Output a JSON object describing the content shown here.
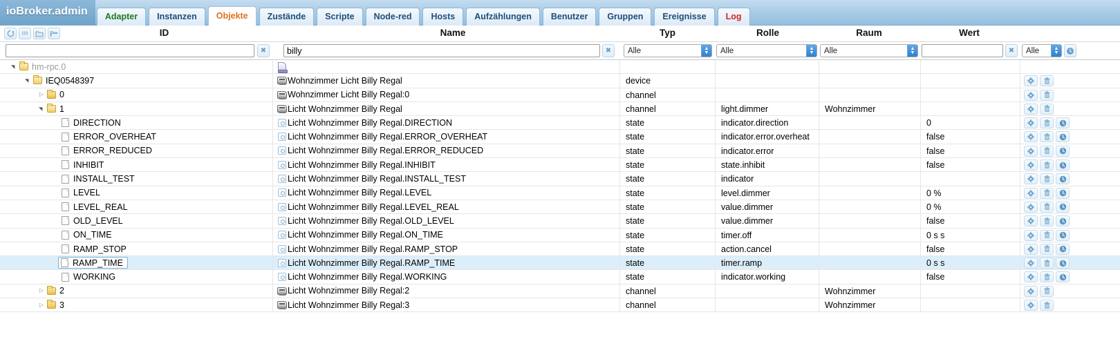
{
  "app": {
    "brand": "ioBroker.admin"
  },
  "tabs": [
    {
      "label": "Adapter",
      "style": "green",
      "active": false
    },
    {
      "label": "Instanzen",
      "style": "normal",
      "active": false
    },
    {
      "label": "Objekte",
      "style": "normal",
      "active": true
    },
    {
      "label": "Zustände",
      "style": "normal",
      "active": false
    },
    {
      "label": "Scripte",
      "style": "normal",
      "active": false
    },
    {
      "label": "Node-red",
      "style": "normal",
      "active": false
    },
    {
      "label": "Hosts",
      "style": "normal",
      "active": false
    },
    {
      "label": "Aufzählungen",
      "style": "normal",
      "active": false
    },
    {
      "label": "Benutzer",
      "style": "normal",
      "active": false
    },
    {
      "label": "Gruppen",
      "style": "normal",
      "active": false
    },
    {
      "label": "Ereignisse",
      "style": "normal",
      "active": false
    },
    {
      "label": "Log",
      "style": "red",
      "active": false
    }
  ],
  "toolbar": {
    "buttons": [
      {
        "name": "refresh-icon",
        "title": "Aktualisieren"
      },
      {
        "name": "list-icon",
        "title": "Liste"
      },
      {
        "name": "collapse-all-icon",
        "title": "Alle einklappen"
      },
      {
        "name": "expand-all-icon",
        "title": "Alle ausklappen"
      }
    ]
  },
  "columns": {
    "id": "ID",
    "name": "Name",
    "typ": "Typ",
    "rolle": "Rolle",
    "raum": "Raum",
    "wert": "Wert"
  },
  "filters": {
    "id_value": "",
    "id_placeholder": "",
    "name_value": "billy",
    "name_placeholder": "",
    "typ_value": "Alle",
    "rolle_value": "Alle",
    "raum_value": "Alle",
    "wert_value": "",
    "wert_placeholder": "",
    "quality_value": "Alle",
    "clear_label": "✖",
    "select_options": [
      "Alle"
    ]
  },
  "rows": [
    {
      "indent": 0,
      "arrow": "open",
      "icon": "folder",
      "id": "hm-rpc.0",
      "id_dim": true,
      "name": "",
      "name_icon": "adapter",
      "typ": "",
      "rolle": "",
      "raum": "",
      "wert": "",
      "actions": [],
      "selected": false
    },
    {
      "indent": 1,
      "arrow": "open",
      "icon": "folder",
      "id": "IEQ0548397",
      "id_dim": false,
      "name": "Wohnzimmer Licht Billy Regal",
      "name_icon": "device",
      "typ": "device",
      "rolle": "",
      "raum": "",
      "wert": "",
      "actions": [
        "gear",
        "trash"
      ],
      "selected": false
    },
    {
      "indent": 2,
      "arrow": "closed",
      "icon": "folder",
      "id": "0",
      "id_dim": false,
      "name": "Wohnzimmer Licht Billy Regal:0",
      "name_icon": "device",
      "typ": "channel",
      "rolle": "",
      "raum": "",
      "wert": "",
      "actions": [
        "gear",
        "trash"
      ],
      "selected": false
    },
    {
      "indent": 2,
      "arrow": "open",
      "icon": "folder",
      "id": "1",
      "id_dim": false,
      "name": "Licht Wohnzimmer Billy Regal",
      "name_icon": "device",
      "typ": "channel",
      "rolle": "light.dimmer",
      "raum": "Wohnzimmer",
      "wert": "",
      "actions": [
        "gear",
        "trash"
      ],
      "selected": false
    },
    {
      "indent": 3,
      "arrow": "none",
      "icon": "doc",
      "id": "DIRECTION",
      "id_dim": false,
      "name": "Licht Wohnzimmer Billy Regal.DIRECTION",
      "name_icon": "state",
      "typ": "state",
      "rolle": "indicator.direction",
      "raum": "",
      "wert": "0",
      "actions": [
        "gear",
        "trash",
        "clock"
      ],
      "selected": false
    },
    {
      "indent": 3,
      "arrow": "none",
      "icon": "doc",
      "id": "ERROR_OVERHEAT",
      "id_dim": false,
      "name": "Licht Wohnzimmer Billy Regal.ERROR_OVERHEAT",
      "name_icon": "state",
      "typ": "state",
      "rolle": "indicator.error.overheat",
      "raum": "",
      "wert": "false",
      "actions": [
        "gear",
        "trash",
        "clock"
      ],
      "selected": false
    },
    {
      "indent": 3,
      "arrow": "none",
      "icon": "doc",
      "id": "ERROR_REDUCED",
      "id_dim": false,
      "name": "Licht Wohnzimmer Billy Regal.ERROR_REDUCED",
      "name_icon": "state",
      "typ": "state",
      "rolle": "indicator.error",
      "raum": "",
      "wert": "false",
      "actions": [
        "gear",
        "trash",
        "clock"
      ],
      "selected": false
    },
    {
      "indent": 3,
      "arrow": "none",
      "icon": "doc",
      "id": "INHIBIT",
      "id_dim": false,
      "name": "Licht Wohnzimmer Billy Regal.INHIBIT",
      "name_icon": "state",
      "typ": "state",
      "rolle": "state.inhibit",
      "raum": "",
      "wert": "false",
      "actions": [
        "gear",
        "trash",
        "clock"
      ],
      "selected": false
    },
    {
      "indent": 3,
      "arrow": "none",
      "icon": "doc",
      "id": "INSTALL_TEST",
      "id_dim": false,
      "name": "Licht Wohnzimmer Billy Regal.INSTALL_TEST",
      "name_icon": "state",
      "typ": "state",
      "rolle": "indicator",
      "raum": "",
      "wert": "",
      "actions": [
        "gear",
        "trash",
        "clock"
      ],
      "selected": false
    },
    {
      "indent": 3,
      "arrow": "none",
      "icon": "doc",
      "id": "LEVEL",
      "id_dim": false,
      "name": "Licht Wohnzimmer Billy Regal.LEVEL",
      "name_icon": "state",
      "typ": "state",
      "rolle": "level.dimmer",
      "raum": "",
      "wert": "0 %",
      "actions": [
        "gear",
        "trash",
        "clock"
      ],
      "selected": false
    },
    {
      "indent": 3,
      "arrow": "none",
      "icon": "doc",
      "id": "LEVEL_REAL",
      "id_dim": false,
      "name": "Licht Wohnzimmer Billy Regal.LEVEL_REAL",
      "name_icon": "state",
      "typ": "state",
      "rolle": "value.dimmer",
      "raum": "",
      "wert": "0 %",
      "actions": [
        "gear",
        "trash",
        "clock"
      ],
      "selected": false
    },
    {
      "indent": 3,
      "arrow": "none",
      "icon": "doc",
      "id": "OLD_LEVEL",
      "id_dim": false,
      "name": "Licht Wohnzimmer Billy Regal.OLD_LEVEL",
      "name_icon": "state",
      "typ": "state",
      "rolle": "value.dimmer",
      "raum": "",
      "wert": "false",
      "actions": [
        "gear",
        "trash",
        "clock"
      ],
      "selected": false
    },
    {
      "indent": 3,
      "arrow": "none",
      "icon": "doc",
      "id": "ON_TIME",
      "id_dim": false,
      "name": "Licht Wohnzimmer Billy Regal.ON_TIME",
      "name_icon": "state",
      "typ": "state",
      "rolle": "timer.off",
      "raum": "",
      "wert": "0 s s",
      "actions": [
        "gear",
        "trash",
        "clock"
      ],
      "selected": false
    },
    {
      "indent": 3,
      "arrow": "none",
      "icon": "doc",
      "id": "RAMP_STOP",
      "id_dim": false,
      "name": "Licht Wohnzimmer Billy Regal.RAMP_STOP",
      "name_icon": "state",
      "typ": "state",
      "rolle": "action.cancel",
      "raum": "",
      "wert": "false",
      "actions": [
        "gear",
        "trash",
        "clock"
      ],
      "selected": false
    },
    {
      "indent": 3,
      "arrow": "none",
      "icon": "doc",
      "id": "RAMP_TIME",
      "id_dim": false,
      "name": "Licht Wohnzimmer Billy Regal.RAMP_TIME",
      "name_icon": "state",
      "typ": "state",
      "rolle": "timer.ramp",
      "raum": "",
      "wert": "0 s s",
      "actions": [
        "gear",
        "trash",
        "clock"
      ],
      "selected": true
    },
    {
      "indent": 3,
      "arrow": "none",
      "icon": "doc",
      "id": "WORKING",
      "id_dim": false,
      "name": "Licht Wohnzimmer Billy Regal.WORKING",
      "name_icon": "state",
      "typ": "state",
      "rolle": "indicator.working",
      "raum": "",
      "wert": "false",
      "actions": [
        "gear",
        "trash",
        "clock"
      ],
      "selected": false
    },
    {
      "indent": 2,
      "arrow": "closed",
      "icon": "folder",
      "id": "2",
      "id_dim": false,
      "name": "Licht Wohnzimmer Billy Regal:2",
      "name_icon": "device",
      "typ": "channel",
      "rolle": "",
      "raum": "Wohnzimmer",
      "wert": "",
      "actions": [
        "gear",
        "trash"
      ],
      "selected": false
    },
    {
      "indent": 2,
      "arrow": "closed",
      "icon": "folder",
      "id": "3",
      "id_dim": false,
      "name": "Licht Wohnzimmer Billy Regal:3",
      "name_icon": "device",
      "typ": "channel",
      "rolle": "",
      "raum": "Wohnzimmer",
      "wert": "",
      "actions": [
        "gear",
        "trash"
      ],
      "selected": false
    }
  ],
  "action_icons": {
    "gear": "gear-icon",
    "trash": "trash-icon",
    "clock": "clock-icon"
  }
}
